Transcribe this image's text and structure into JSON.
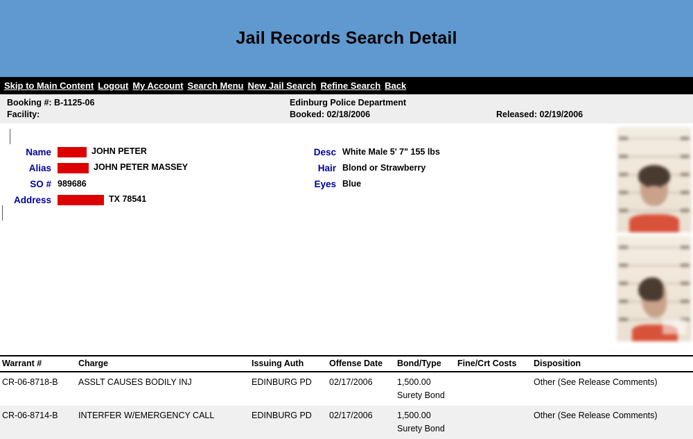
{
  "header": {
    "title": "Jail Records Search Detail",
    "background_color": "#6099cf"
  },
  "nav": {
    "background_color": "#000000",
    "links": [
      "Skip to Main Content",
      "Logout",
      "My Account",
      "Search Menu",
      "New Jail Search",
      "Refine Search",
      " Back"
    ]
  },
  "booking": {
    "booking_number_label": "Booking #: B-1125-06",
    "facility_label": "Facility:",
    "agency": "Edinburg Police Department",
    "booked": "Booked: 02/18/2006",
    "released": "Released: 02/19/2006"
  },
  "subject": {
    "labels": {
      "name": "Name",
      "alias": "Alias",
      "so": "SO #",
      "address": "Address",
      "desc": "Desc",
      "hair": "Hair",
      "eyes": "Eyes"
    },
    "name_value": "JOHN PETER",
    "alias_value": "JOHN PETER MASSEY",
    "so_value": "989686",
    "address_value": "TX 78541",
    "desc_value": "White  Male  5' 7\"   155 lbs",
    "hair_value": "Blond or Strawberry",
    "eyes_value": "Blue",
    "label_color": "#00009c",
    "redaction_color": "#dd0000"
  },
  "photos": {
    "front_alt": "mugshot-front",
    "profile_alt": "mugshot-profile"
  },
  "warrants": {
    "columns": [
      "Warrant #",
      "Charge",
      "Issuing Auth",
      "Offense Date",
      "Bond/Type",
      "Fine/Crt Costs",
      "Disposition"
    ],
    "rows": [
      {
        "warrant": "CR-06-8718-B",
        "charge": "ASSLT CAUSES BODILY INJ",
        "issuing": "EDINBURG PD",
        "offense_date": "02/17/2006",
        "bond_amount": "1,500.00",
        "bond_type": "Surety Bond",
        "fine": "",
        "disposition": "Other (See Release Comments)"
      },
      {
        "warrant": "CR-06-8714-B",
        "charge": "INTERFER W/EMERGENCY CALL",
        "issuing": "EDINBURG PD",
        "offense_date": "02/17/2006",
        "bond_amount": "1,500.00",
        "bond_type": "Surety Bond",
        "fine": "",
        "disposition": "Other (See Release Comments)"
      }
    ]
  }
}
